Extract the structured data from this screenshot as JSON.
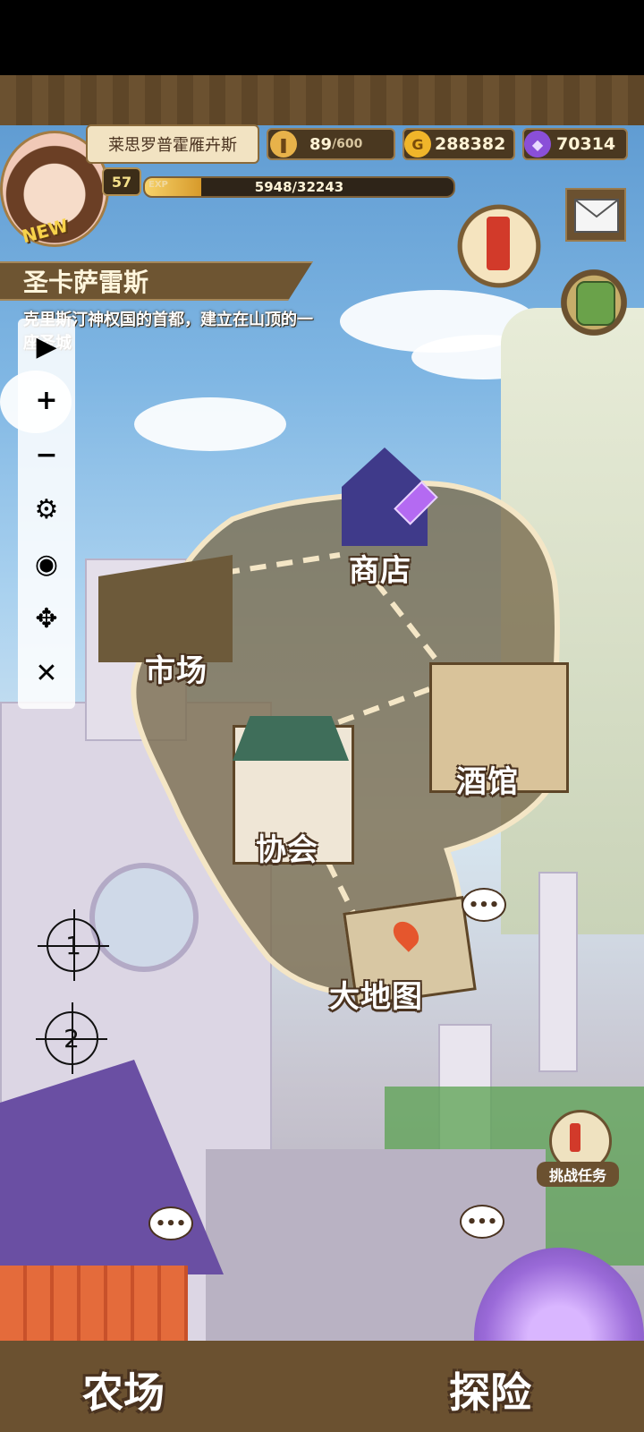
{
  "player": {
    "name": "莱思罗普霍雁卉斯",
    "level": "57",
    "new_badge": "NEW",
    "exp_tag": "EXP",
    "exp_text": "5948/32243",
    "exp_fraction": 0.184
  },
  "resources": {
    "stamina": "89",
    "stamina_max": "/600",
    "gold_symbol": "G",
    "gold": "288382",
    "gems": "70314"
  },
  "location": {
    "title": "圣卡萨雷斯",
    "description": "克里斯汀神权国的首都，建立在山顶的一座圣城"
  },
  "toolbar": {
    "play": "▶",
    "zoom_in": "+",
    "zoom_out": "−",
    "settings": "⚙",
    "hide": "◉",
    "move": "✥",
    "close": "✕"
  },
  "markers": {
    "m1": "1",
    "m2": "2"
  },
  "map_nodes": {
    "shop": "商店",
    "market": "市场",
    "tavern": "酒馆",
    "guild": "协会",
    "world_map": "大地图"
  },
  "bubbles": {
    "dots": "•••"
  },
  "challenge": {
    "label": "挑战任务"
  },
  "bottom": {
    "farm": "农场",
    "explore": "探险"
  },
  "icons": {
    "stamina": "bread-icon",
    "gold": "gold-coin-icon",
    "gem": "purple-gem-icon",
    "quest": "quest-scroll-icon",
    "mail": "mail-icon",
    "bag": "backpack-icon"
  },
  "colors": {
    "frame": "#6b5130",
    "gold": "#f0b52a",
    "gem": "#8a4fd8"
  }
}
